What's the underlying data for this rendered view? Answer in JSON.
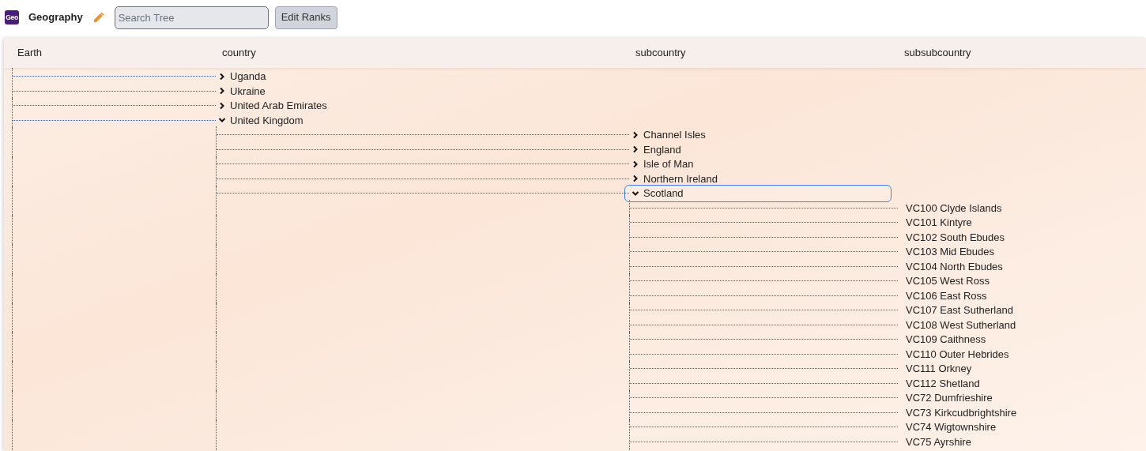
{
  "toolbar": {
    "app_logo": "Geo",
    "title": "Geography",
    "search": {
      "placeholder": "Search Tree"
    },
    "buttons": [
      "Edit Ranks"
    ]
  },
  "rank_headers": [
    "Earth",
    "country",
    "subcountry",
    "subsubcountry"
  ],
  "tree": [
    {
      "label": "Uganda",
      "kind": "branch",
      "expanded": false,
      "selected": false
    },
    {
      "label": "Ukraine",
      "kind": "branch",
      "expanded": false,
      "selected": false
    },
    {
      "label": "United Arab Emirates",
      "kind": "branch",
      "expanded": false,
      "selected": false
    },
    {
      "label": "United Kingdom",
      "kind": "branch",
      "expanded": true,
      "selected": false,
      "children": [
        {
          "label": "Channel Isles",
          "kind": "branch",
          "expanded": false,
          "selected": false
        },
        {
          "label": "England",
          "kind": "branch",
          "expanded": false,
          "selected": false
        },
        {
          "label": "Isle of Man",
          "kind": "branch",
          "expanded": false,
          "selected": false
        },
        {
          "label": "Northern Ireland",
          "kind": "branch",
          "expanded": false,
          "selected": false
        },
        {
          "label": "Scotland",
          "kind": "branch",
          "expanded": true,
          "selected": true,
          "children": [
            {
              "label": "VC100 Clyde Islands",
              "kind": "leaf",
              "selected": false
            },
            {
              "label": "VC101 Kintyre",
              "kind": "leaf",
              "selected": false
            },
            {
              "label": "VC102 South Ebudes",
              "kind": "leaf",
              "selected": false
            },
            {
              "label": "VC103 Mid Ebudes",
              "kind": "leaf",
              "selected": false
            },
            {
              "label": "VC104 North Ebudes",
              "kind": "leaf",
              "selected": false
            },
            {
              "label": "VC105 West Ross",
              "kind": "leaf",
              "selected": false
            },
            {
              "label": "VC106 East Ross",
              "kind": "leaf",
              "selected": false
            },
            {
              "label": "VC107 East Sutherland",
              "kind": "leaf",
              "selected": false
            },
            {
              "label": "VC108 West Sutherland",
              "kind": "leaf",
              "selected": false
            },
            {
              "label": "VC109 Caithness",
              "kind": "leaf",
              "selected": false
            },
            {
              "label": "VC110 Outer Hebrides",
              "kind": "leaf",
              "selected": false
            },
            {
              "label": "VC111 Orkney",
              "kind": "leaf",
              "selected": false
            },
            {
              "label": "VC112 Shetland",
              "kind": "leaf",
              "selected": false
            },
            {
              "label": "VC72 Dumfrieshire",
              "kind": "leaf",
              "selected": false
            },
            {
              "label": "VC73 Kirkcudbrightshire",
              "kind": "leaf",
              "selected": false
            },
            {
              "label": "VC74 Wigtownshire",
              "kind": "leaf",
              "selected": false
            },
            {
              "label": "VC75 Ayrshire",
              "kind": "leaf",
              "selected": false
            }
          ]
        }
      ]
    }
  ]
}
